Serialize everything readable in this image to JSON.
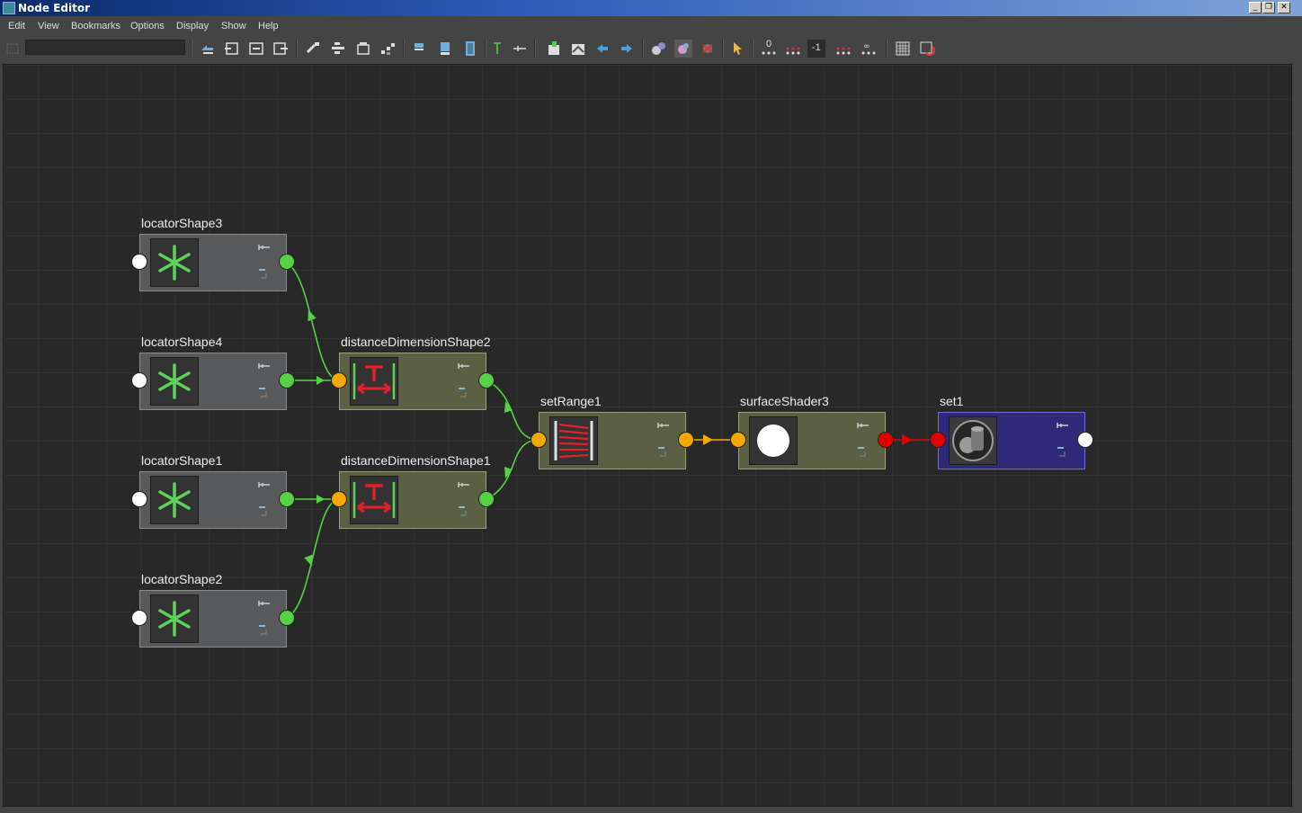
{
  "window": {
    "title": "Node Editor"
  },
  "menubar": {
    "items": [
      "Edit",
      "View",
      "Bookmarks",
      "Options",
      "Display",
      "Show",
      "Help"
    ]
  },
  "toolbar": {
    "label_zero": "0",
    "label_neg_one": "-1",
    "colors": {
      "accent_green": "#55d244",
      "accent_orange": "#f5a800",
      "accent_red": "#e50000"
    }
  },
  "nodes": {
    "locatorShape3": {
      "name": "locatorShape3",
      "type": "locator",
      "icon": "locator-asterisk-icon"
    },
    "locatorShape4": {
      "name": "locatorShape4",
      "type": "locator",
      "icon": "locator-asterisk-icon"
    },
    "locatorShape1": {
      "name": "locatorShape1",
      "type": "locator",
      "icon": "locator-asterisk-icon"
    },
    "locatorShape2": {
      "name": "locatorShape2",
      "type": "locator",
      "icon": "locator-asterisk-icon"
    },
    "distanceDimensionShape2": {
      "name": "distanceDimensionShape2",
      "type": "distanceDimension",
      "icon": "distance-dimension-icon"
    },
    "distanceDimensionShape1": {
      "name": "distanceDimensionShape1",
      "type": "distanceDimension",
      "icon": "distance-dimension-icon"
    },
    "setRange1": {
      "name": "setRange1",
      "type": "setRange",
      "icon": "set-range-icon"
    },
    "surfaceShader3": {
      "name": "surfaceShader3",
      "type": "surfaceShader",
      "icon": "white-sphere-icon"
    },
    "set1": {
      "name": "set1",
      "type": "shadingEngine",
      "icon": "shading-group-icon"
    }
  },
  "connections": [
    {
      "from": "locatorShape3",
      "to": "distanceDimensionShape2",
      "color": "#55d244"
    },
    {
      "from": "locatorShape4",
      "to": "distanceDimensionShape2",
      "color": "#55d244"
    },
    {
      "from": "locatorShape1",
      "to": "distanceDimensionShape1",
      "color": "#55d244"
    },
    {
      "from": "locatorShape2",
      "to": "distanceDimensionShape1",
      "color": "#55d244"
    },
    {
      "from": "distanceDimensionShape2",
      "to": "setRange1",
      "color": "#55d244"
    },
    {
      "from": "distanceDimensionShape1",
      "to": "setRange1",
      "color": "#55d244"
    },
    {
      "from": "setRange1",
      "to": "surfaceShader3",
      "color": "#f5a800"
    },
    {
      "from": "surfaceShader3",
      "to": "set1",
      "color": "#e50000"
    }
  ]
}
